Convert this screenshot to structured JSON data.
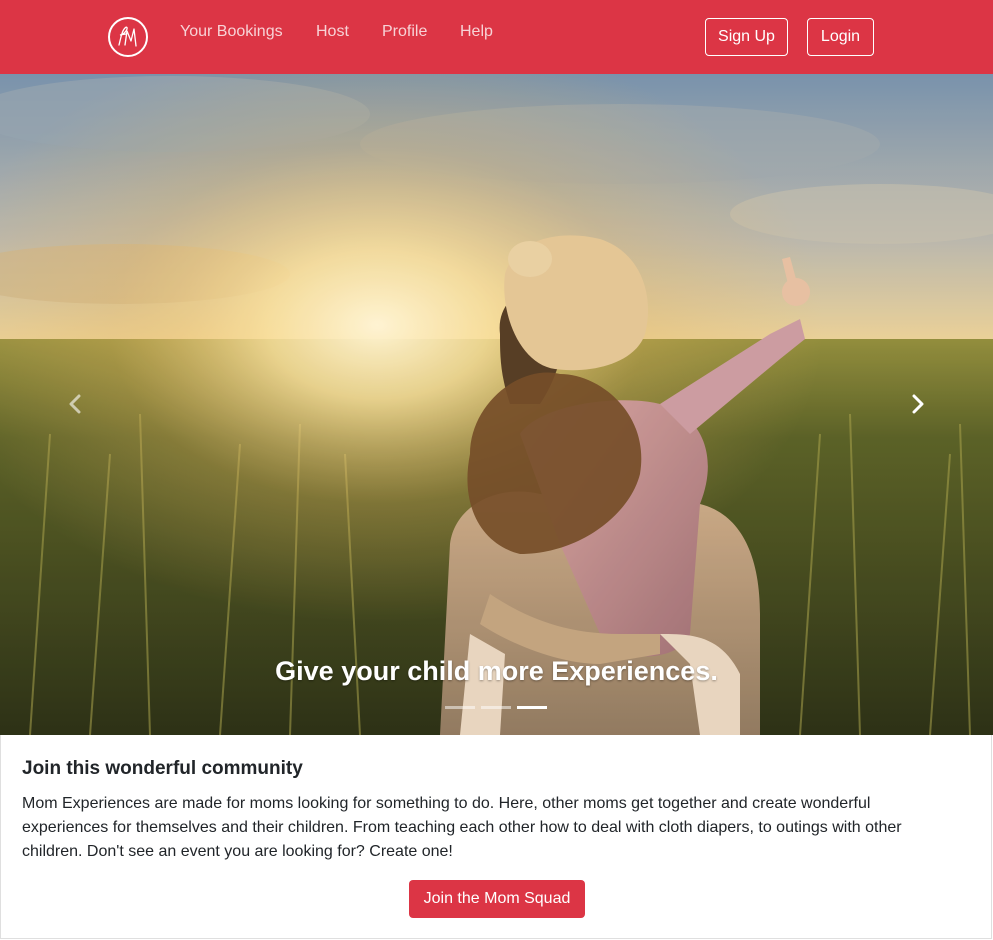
{
  "brand": {
    "logo_letters": "fM",
    "logo_icon": "fm-monogram-icon"
  },
  "nav": {
    "links": [
      {
        "label": "Your Bookings"
      },
      {
        "label": "Host"
      },
      {
        "label": "Profile"
      },
      {
        "label": "Help"
      }
    ],
    "signup_label": "Sign Up",
    "login_label": "Login"
  },
  "carousel": {
    "caption": "Give your child more Experiences.",
    "prev_icon": "chevron-left-icon",
    "next_icon": "chevron-right-icon",
    "slide_count": 3,
    "active_slide": 3,
    "image_subject": "parent carrying child on back in a field at sunset"
  },
  "card": {
    "title": "Join this wonderful community",
    "body": "Mom Experiences are made for moms looking for something to do. Here, other moms get together and create wonderful experiences for themselves and their children. From teaching each other how to deal with cloth diapers, to outings with other children. Don't see an event you are looking for? Create one!",
    "cta_label": "Join the Mom Squad"
  },
  "colors": {
    "brand_red": "#dc3545",
    "white": "#ffffff",
    "text_dark": "#212529"
  }
}
